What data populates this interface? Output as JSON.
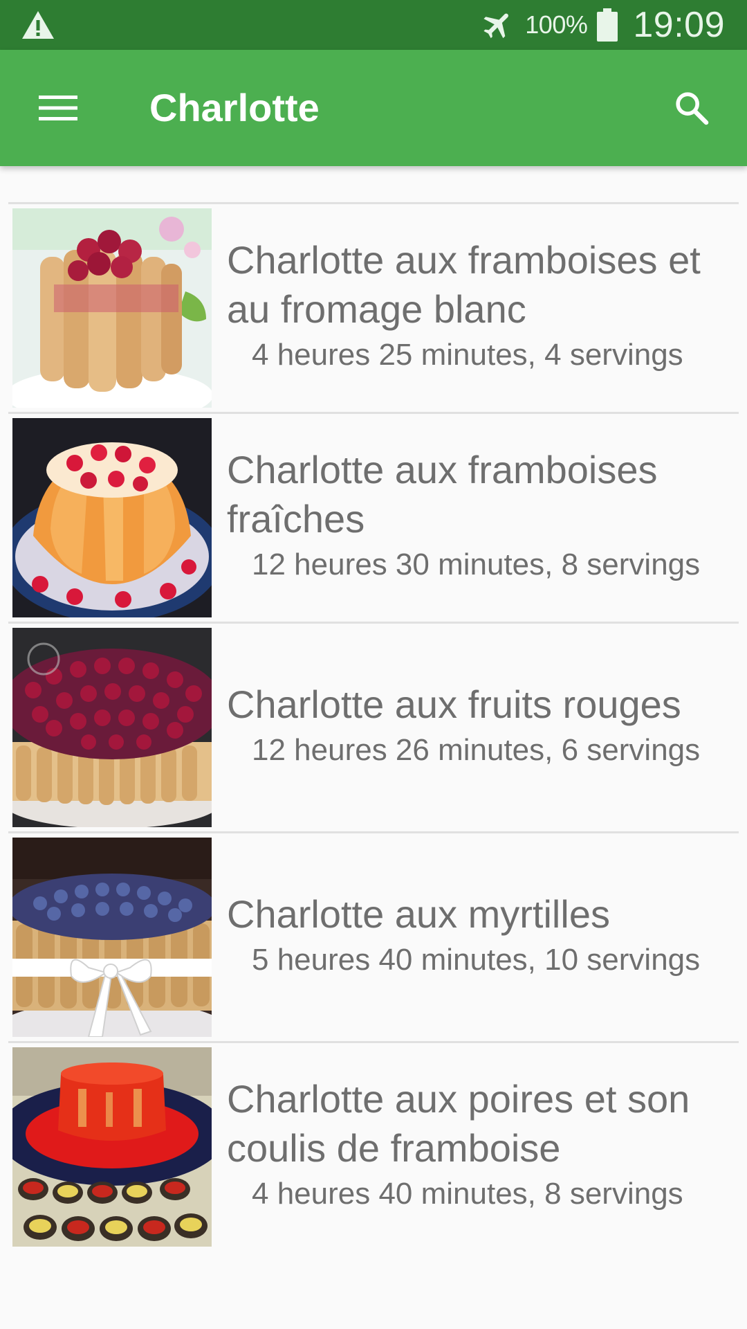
{
  "status_bar": {
    "battery_percent": "100%",
    "time": "19:09",
    "icons": [
      "warning-icon",
      "airplane-mode-icon",
      "battery-icon"
    ]
  },
  "toolbar": {
    "title": "Charlotte",
    "icons": [
      "menu-icon",
      "search-icon"
    ],
    "color": "#4caf50"
  },
  "recipes": [
    {
      "name": "Charlotte aux framboises et au fromage blanc",
      "details": "4 heures 25 minutes, 4 servings"
    },
    {
      "name": "Charlotte aux framboises fraîches",
      "details": "12 heures 30 minutes, 8 servings"
    },
    {
      "name": "Charlotte aux fruits rouges",
      "details": "12 heures 26 minutes, 6 servings"
    },
    {
      "name": "Charlotte aux myrtilles",
      "details": "5 heures 40 minutes, 10 servings"
    },
    {
      "name": "Charlotte aux poires et son coulis de framboise",
      "details": "4 heures 40 minutes, 8 servings"
    }
  ],
  "colors": {
    "status_bar": "#2e7d32",
    "toolbar": "#4caf50",
    "text": "#6e6e6e",
    "background": "#fafafa"
  }
}
